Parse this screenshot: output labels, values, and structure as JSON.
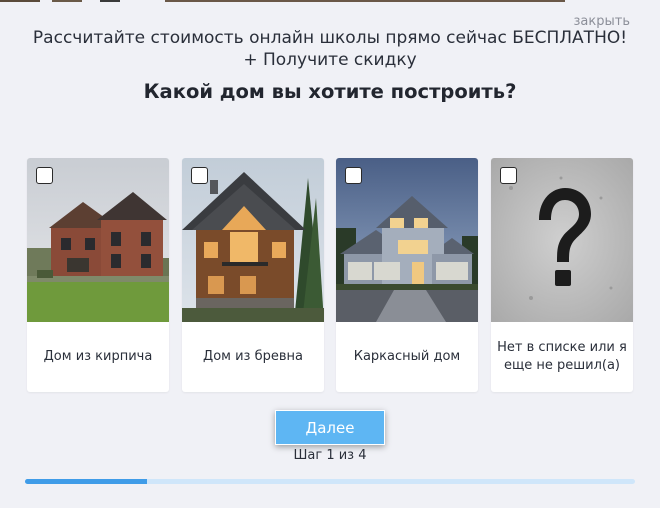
{
  "popup": {
    "close_label": "закрыть",
    "headline_line1": "Рассчитайте стоимость онлайн школы прямо сейчас БЕСПЛАТНО!",
    "headline_line2": "+ Получите скидку",
    "question": "Какой дом вы хотите построить?"
  },
  "options": [
    {
      "label": "Дом из кирпича",
      "checked": false,
      "image": "brick-house-photo"
    },
    {
      "label": "Дом из бревна",
      "checked": false,
      "image": "log-house-photo"
    },
    {
      "label": "Каркасный дом",
      "checked": false,
      "image": "frame-house-photo"
    },
    {
      "label": "Нет в списке или я еще не решил(а)",
      "checked": false,
      "image": "question-mark-image"
    }
  ],
  "next_button_label": "Далее",
  "step_text": "Шаг 1 из 4",
  "progress_fraction": 0.2,
  "colors": {
    "accent": "#5eb6f3",
    "progress_fill": "#3f9ce8",
    "progress_track": "#cfe6fa",
    "background": "#f0f1f6"
  }
}
